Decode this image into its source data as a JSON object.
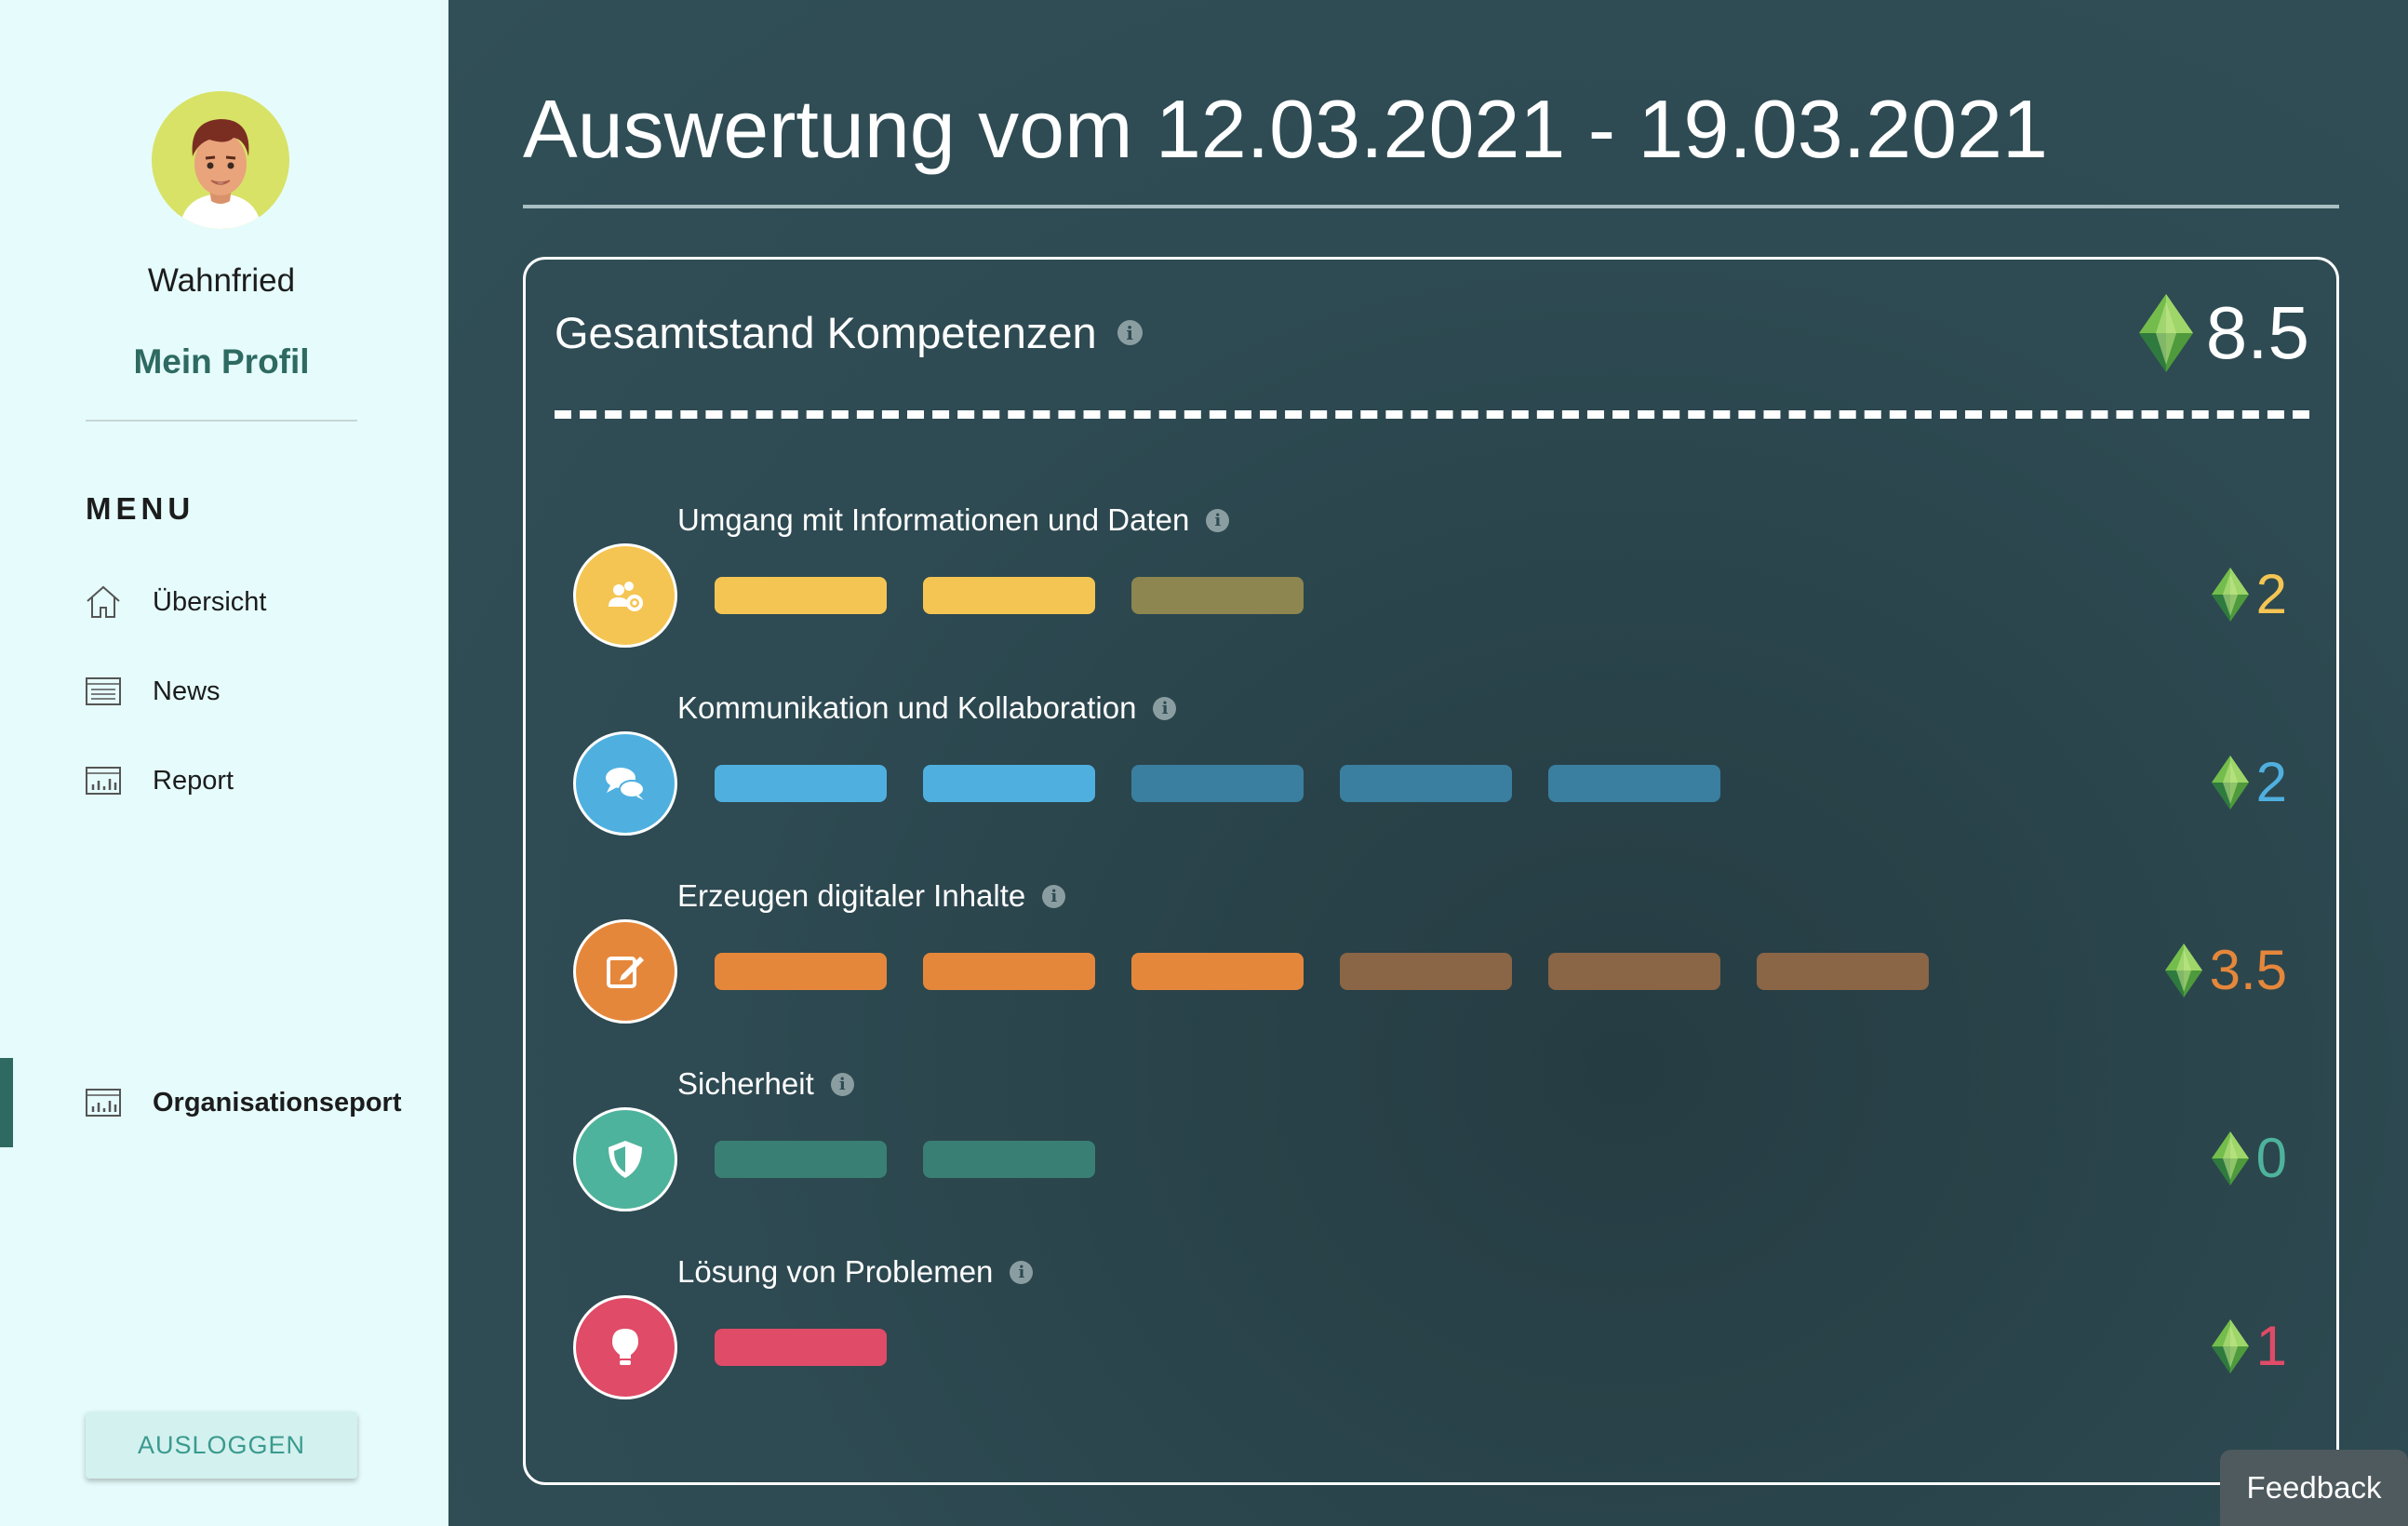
{
  "sidebar": {
    "username": "Wahnfried",
    "profile_label": "Mein Profil",
    "menu_heading": "MENU",
    "nav": [
      {
        "label": "Übersicht",
        "icon": "home-icon"
      },
      {
        "label": "News",
        "icon": "news-icon"
      },
      {
        "label": "Report",
        "icon": "report-icon"
      }
    ],
    "org_report_label": "Organisationseport",
    "logout_label": "AUSLOGGEN"
  },
  "main": {
    "title": "Auswertung vom 12.03.2021 - 19.03.2021",
    "card": {
      "title": "Gesamtstand Kompetenzen",
      "total_score": "8.5",
      "competencies": [
        {
          "label": "Umgang mit Informationen und Daten",
          "score": "2",
          "color": "#f5c553",
          "dim_color": "#8e8650",
          "filled": 2,
          "total": 3,
          "icon": "people-gear-icon"
        },
        {
          "label": "Kommunikation und Kollaboration",
          "score": "2",
          "color": "#4fb0e0",
          "dim_color": "#3a7fa0",
          "filled": 2,
          "total": 5,
          "icon": "chat-bubbles-icon"
        },
        {
          "label": "Erzeugen digitaler Inhalte",
          "score": "3.5",
          "color": "#e5873b",
          "dim_color": "#8a6546",
          "filled": 3,
          "total": 6,
          "icon": "edit-icon"
        },
        {
          "label": "Sicherheit",
          "score": "0",
          "color": "#4eb39c",
          "dim_color": "#3a7f74",
          "filled": 0,
          "total": 2,
          "icon": "shield-icon"
        },
        {
          "label": "Lösung von Problemen",
          "score": "1",
          "color": "#e04b67",
          "dim_color": "#e04b67",
          "filled": 1,
          "total": 1,
          "icon": "lightbulb-icon"
        }
      ]
    }
  },
  "feedback_label": "Feedback",
  "colors": {
    "sidebar_bg": "#e6fcfc",
    "main_bg": "#2e4a52",
    "accent": "#2e6a62"
  }
}
